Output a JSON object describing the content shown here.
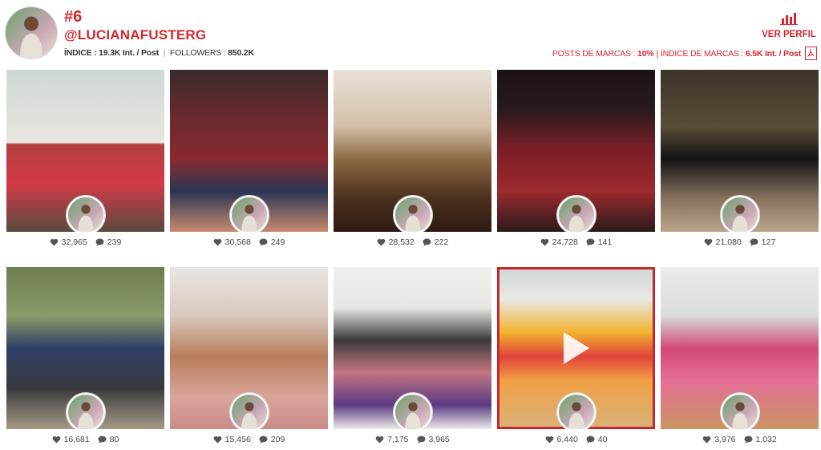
{
  "header": {
    "rank": "#6",
    "username": "@LUCIANAFUSTERG",
    "indice_label": "ÍNDICE :",
    "indice_value": "19.3K Int. / Post",
    "followers_label": "FOLLOWERS :",
    "followers_value": "850.2K",
    "ver_perfil": "VER PERFIL",
    "posts_marcas_label": "POSTS DE MARCAS :",
    "posts_marcas_value": "10%",
    "indice_marcas_label": "ÍNDICE DE MARCAS :",
    "indice_marcas_value": "6.5K Int. / Post",
    "accent_color": "#d7262e"
  },
  "posts": [
    {
      "likes": "32,965",
      "comments": "239"
    },
    {
      "likes": "30,568",
      "comments": "249"
    },
    {
      "likes": "28,532",
      "comments": "222"
    },
    {
      "likes": "24,728",
      "comments": "141"
    },
    {
      "likes": "21,080",
      "comments": "127"
    },
    {
      "likes": "16,681",
      "comments": "80"
    },
    {
      "likes": "15,456",
      "comments": "209"
    },
    {
      "likes": "7,175",
      "comments": "3,965"
    },
    {
      "likes": "6,440",
      "comments": "40",
      "is_video": true,
      "selected": true
    },
    {
      "likes": "3,976",
      "comments": "1,032"
    }
  ],
  "icons": {
    "like": "heart-icon",
    "comment": "speech-bubble-icon",
    "profile": "bar-chart-icon",
    "export": "pdf-icon",
    "video": "play-icon"
  }
}
